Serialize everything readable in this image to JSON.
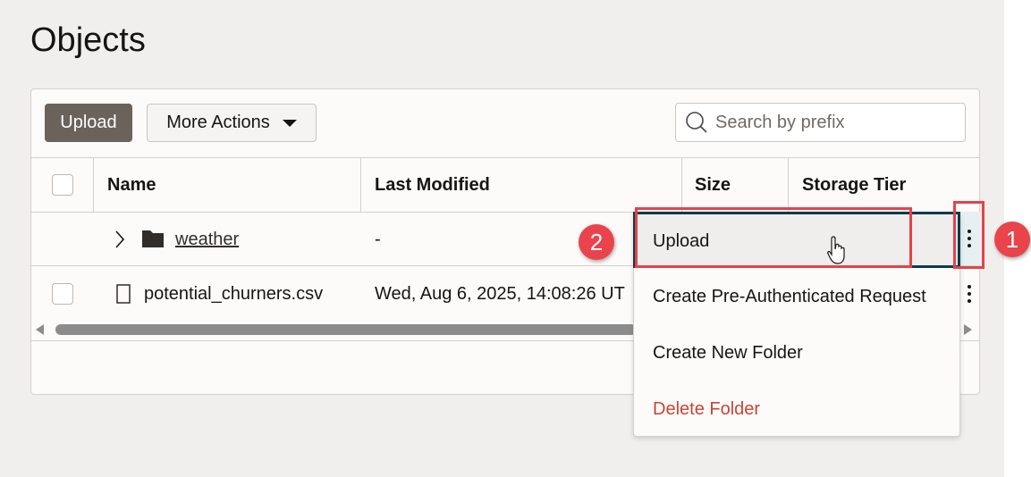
{
  "page": {
    "title": "Objects"
  },
  "toolbar": {
    "upload_label": "Upload",
    "more_actions_label": "More Actions",
    "search_placeholder": "Search by prefix"
  },
  "table": {
    "columns": [
      "Name",
      "Last Modified",
      "Size",
      "Storage Tier"
    ],
    "rows": [
      {
        "name": "weather",
        "type": "folder",
        "last_modified": "-"
      },
      {
        "name": "potential_churners.csv",
        "type": "file",
        "last_modified": "Wed, Aug 6, 2025, 14:08:26 UT"
      }
    ]
  },
  "context_menu": {
    "items": [
      "Upload",
      "Create Pre-Authenticated Request",
      "Create New Folder",
      "Delete Folder"
    ],
    "danger_color": "#c74634"
  },
  "annotations": {
    "step1": "1",
    "step2": "2",
    "color": "#e9444c"
  }
}
